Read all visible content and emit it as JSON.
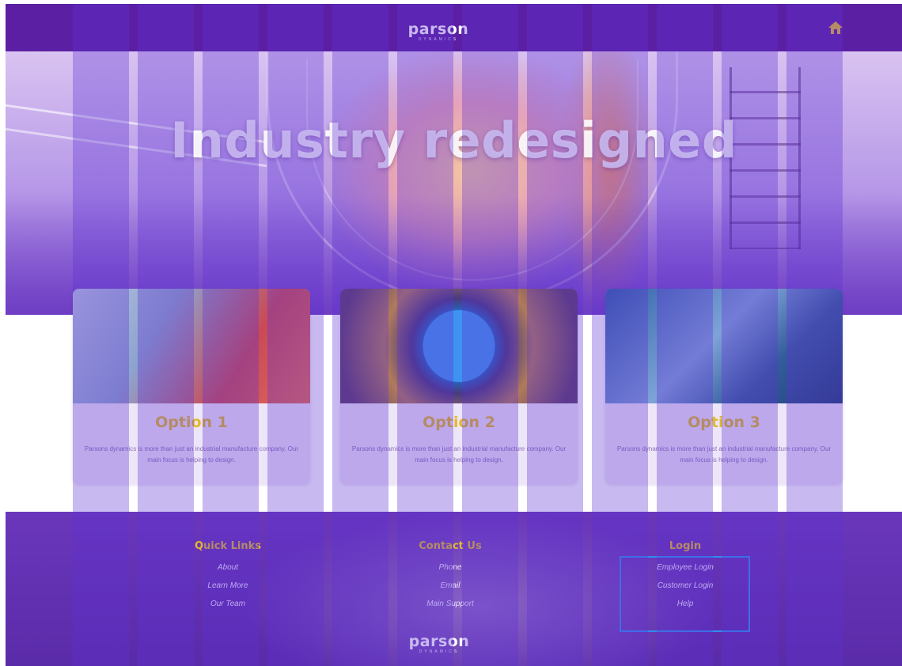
{
  "header": {
    "logo_text": "parson",
    "logo_sub": "DYNAMICS",
    "home_icon": "home-icon",
    "accent": "#e3b92e",
    "bg": "#5b1fa3"
  },
  "hero": {
    "title": "Industry redesigned"
  },
  "cards": [
    {
      "title": "Option 1",
      "desc": "Parsons dynamics is more than just an industrial manufacture company. Our main focus is helping to design."
    },
    {
      "title": "Option 2",
      "desc": "Parsons dynamics is more than just an industrial manufacture company. Our main focus is helping to design."
    },
    {
      "title": "Option 3",
      "desc": "Parsons dynamics is more than just an industrial manufacture company. Our main focus is helping to design."
    }
  ],
  "footer": {
    "quick_links": {
      "heading": "Quick Links",
      "items": [
        "About",
        "Learn More",
        "Our Team"
      ]
    },
    "contact": {
      "heading": "Contact Us",
      "items": [
        "Phone",
        "Email",
        "Main Support"
      ]
    },
    "login": {
      "heading": "Login",
      "items": [
        "Employee Login",
        "Customer Login",
        "Help"
      ]
    },
    "logo_text": "parson",
    "logo_sub": "DYNAMICS"
  }
}
